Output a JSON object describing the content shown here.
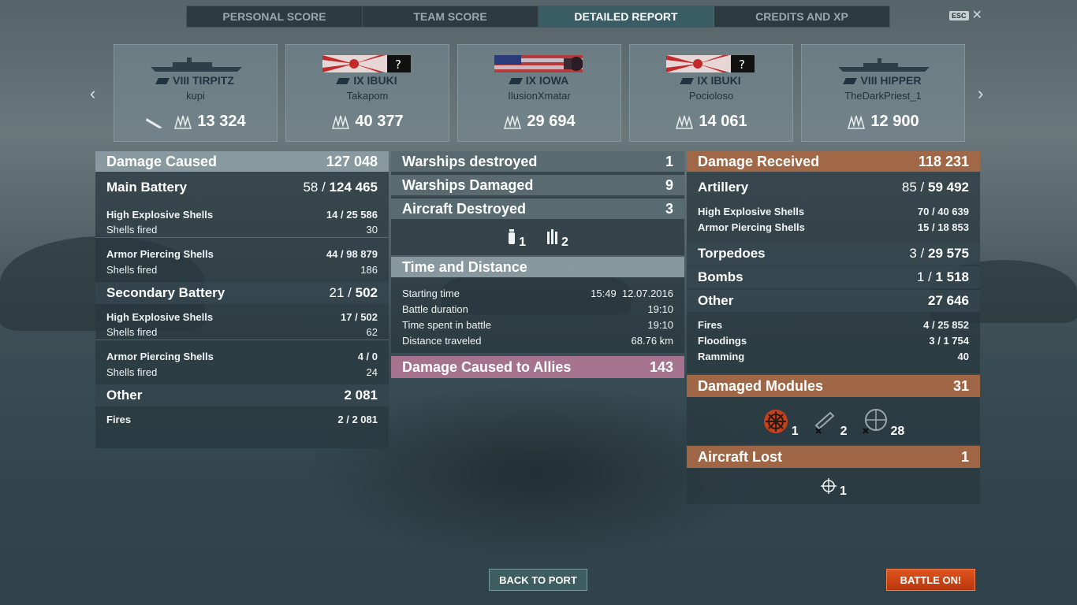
{
  "tabs": [
    "PERSONAL SCORE",
    "TEAM SCORE",
    "DETAILED REPORT",
    "CREDITS AND XP"
  ],
  "esc_label": "ESC",
  "players": [
    {
      "ship": "VIII TIRPITZ",
      "player": "kupi",
      "score": "13 324"
    },
    {
      "ship": "IX IBUKI",
      "player": "Takapom",
      "score": "40 377"
    },
    {
      "ship": "IX IOWA",
      "player": "IlusionXmatar",
      "score": "29 694"
    },
    {
      "ship": "IX IBUKI",
      "player": "Pocioloso",
      "score": "14 061"
    },
    {
      "ship": "VIII HIPPER",
      "player": "TheDarkPriest_1",
      "score": "12 900"
    }
  ],
  "damage_caused": {
    "title": "Damage Caused",
    "total": "127 048",
    "main_battery": {
      "label": "Main Battery",
      "hits": "58",
      "dmg": "124 465",
      "he": {
        "label": "High Explosive Shells",
        "hits": "14",
        "dmg": "25 586",
        "fired_label": "Shells fired",
        "fired": "30"
      },
      "ap": {
        "label": "Armor Piercing Shells",
        "hits": "44",
        "dmg": "98 879",
        "fired_label": "Shells fired",
        "fired": "186"
      }
    },
    "secondary": {
      "label": "Secondary Battery",
      "hits": "21",
      "dmg": "502",
      "he": {
        "label": "High Explosive Shells",
        "hits": "17",
        "dmg": "502",
        "fired_label": "Shells fired",
        "fired": "62"
      },
      "ap": {
        "label": "Armor Piercing Shells",
        "hits": "4",
        "dmg": "0",
        "fired_label": "Shells fired",
        "fired": "24"
      }
    },
    "other": {
      "label": "Other",
      "total": "2 081",
      "fires": {
        "label": "Fires",
        "hits": "2",
        "dmg": "2 081"
      }
    }
  },
  "middle": {
    "destroyed": {
      "label": "Warships destroyed",
      "value": "1"
    },
    "damaged": {
      "label": "Warships Damaged",
      "value": "9"
    },
    "aircraft": {
      "label": "Aircraft Destroyed",
      "value": "3",
      "fighters": "1",
      "bombers": "2"
    },
    "time": {
      "title": "Time and Distance",
      "start_label": "Starting time",
      "start_time": "15:49",
      "start_date": "12.07.2016",
      "duration_label": "Battle duration",
      "duration": "19:10",
      "spent_label": "Time spent in battle",
      "spent": "19:10",
      "distance_label": "Distance traveled",
      "distance": "68.76 km"
    },
    "allies": {
      "label": "Damage Caused to Allies",
      "value": "143"
    }
  },
  "damage_received": {
    "title": "Damage Received",
    "total": "118 231",
    "artillery": {
      "label": "Artillery",
      "hits": "85",
      "dmg": "59 492",
      "he": {
        "label": "High Explosive Shells",
        "hits": "70",
        "dmg": "40 639"
      },
      "ap": {
        "label": "Armor Piercing Shells",
        "hits": "15",
        "dmg": "18 853"
      }
    },
    "torpedoes": {
      "label": "Torpedoes",
      "hits": "3",
      "dmg": "29 575"
    },
    "bombs": {
      "label": "Bombs",
      "hits": "1",
      "dmg": "1 518"
    },
    "other": {
      "label": "Other",
      "total": "27 646",
      "fires": {
        "label": "Fires",
        "hits": "4",
        "dmg": "25 852"
      },
      "floodings": {
        "label": "Floodings",
        "hits": "3",
        "dmg": "1 754"
      },
      "ramming": {
        "label": "Ramming",
        "dmg": "40"
      }
    }
  },
  "modules": {
    "label": "Damaged Modules",
    "total": "31",
    "steering": "1",
    "guns": "2",
    "aa": "28"
  },
  "aircraft_lost": {
    "label": "Aircraft Lost",
    "total": "1",
    "fighters": "1"
  },
  "buttons": {
    "back": "BACK TO PORT",
    "battle": "BATTLE ON!"
  },
  "colors": {
    "accent_orange": "#d9461a",
    "received_header": "#ac6c46",
    "allies_header": "#b27896"
  }
}
